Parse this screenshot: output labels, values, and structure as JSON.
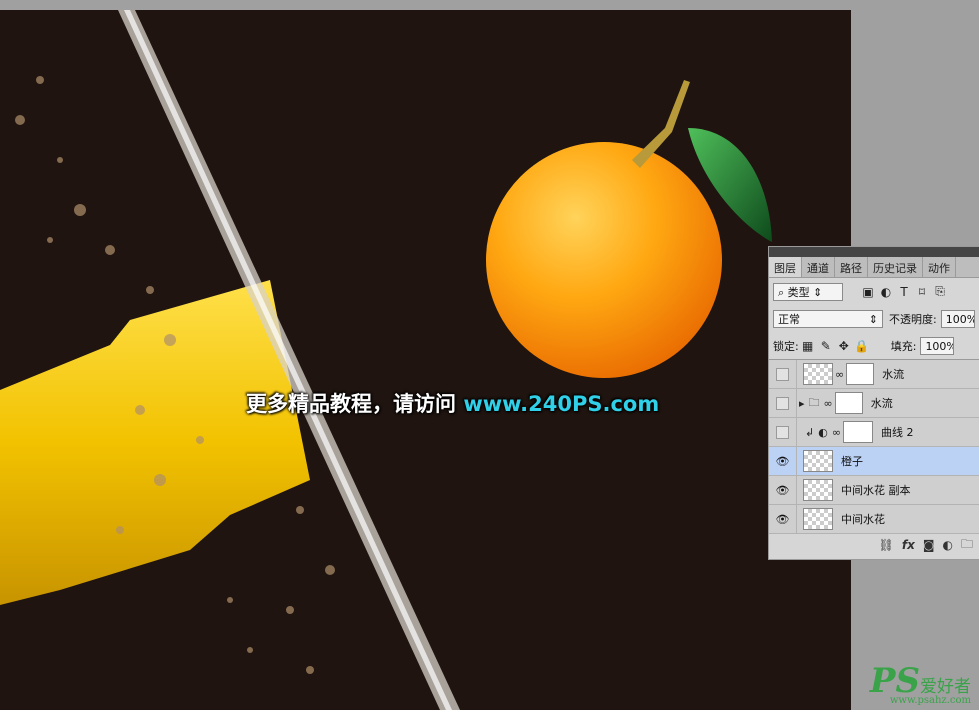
{
  "watermark": {
    "text": "更多精品教程，请访问 ",
    "url": "www.240PS.com"
  },
  "logo": {
    "ps": "PS",
    "cn": "爱好者",
    "site": "www.psahz.com"
  },
  "colors": {
    "canvas_bg": "#1f1410",
    "selected_row": "#bcd2f5",
    "watermark_url": "#2fd0e8",
    "logo_green": "#3aa34a"
  },
  "panel": {
    "tabs": [
      "图层",
      "通道",
      "路径",
      "历史记录",
      "动作"
    ],
    "filter": {
      "search_icon": "search-icon",
      "kind_label": "类型"
    },
    "blend_mode": "正常",
    "opacity_label": "不透明度:",
    "opacity_value": "100%",
    "lock_label": "锁定:",
    "fill_label": "填充:",
    "fill_value": "100%",
    "layers": [
      {
        "name": "水流",
        "visible": false,
        "selected": false
      },
      {
        "name": "水流",
        "visible": false,
        "selected": false
      },
      {
        "name": "曲线 2",
        "visible": false,
        "selected": false
      },
      {
        "name": "橙子",
        "visible": true,
        "selected": true
      },
      {
        "name": "中间水花  副本",
        "visible": true,
        "selected": false
      },
      {
        "name": "中间水花",
        "visible": true,
        "selected": false
      }
    ],
    "bottom_fx": "fx"
  }
}
